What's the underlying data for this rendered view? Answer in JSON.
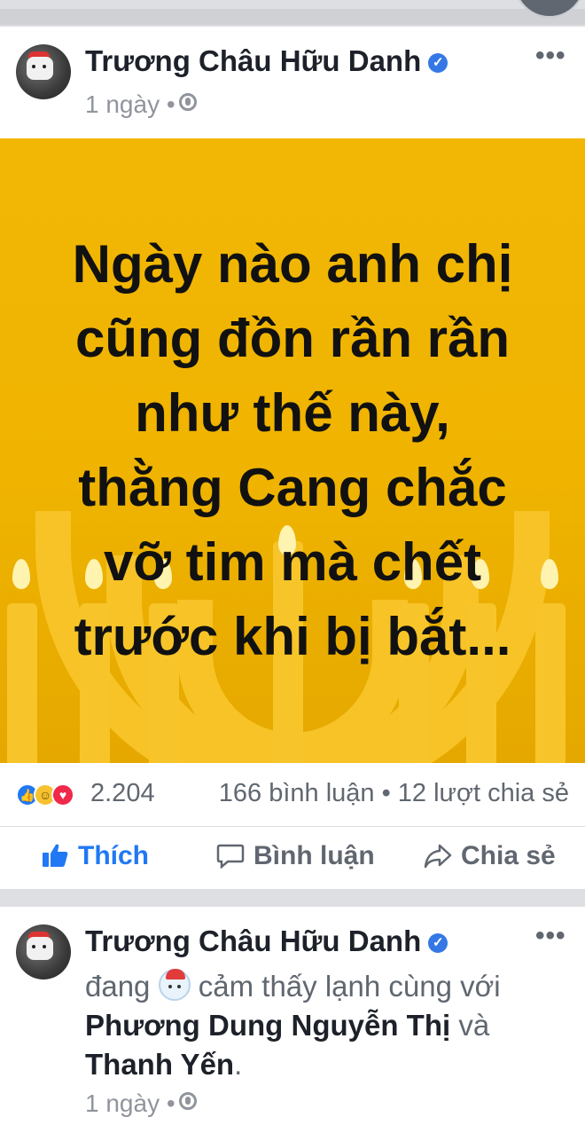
{
  "post1": {
    "author": "Trương Châu Hữu Danh",
    "verified_mark": "✓",
    "time": "1 ngày",
    "separator": "•",
    "more_label": "•••",
    "quote": "Ngày nào anh chị cũng đồn rần rần như thế này, thằng Cang chắc vỡ tim mà chết trước khi bị bắt...",
    "quote_lines": [
      "Ngày nào anh chị",
      "cũng đồn rần rần",
      "như thế này,",
      "thằng Cang chắc",
      "vỡ tim mà chết",
      "trước khi bị bắt..."
    ],
    "reaction_count": "2.204",
    "counts": "166 bình luận • 12 lượt chia sẻ",
    "actions": {
      "like": "Thích",
      "comment": "Bình luận",
      "share": "Chia sẻ"
    },
    "colors": {
      "background": "#f2b705",
      "like_blue": "#2078f4"
    }
  },
  "post2": {
    "author": "Trương Châu Hữu Danh",
    "verified_mark": "✓",
    "status_prefix": "đang",
    "feeling": "cảm thấy lạnh cùng",
    "with": "với",
    "friend1": "Phương Dung Nguyễn Thị",
    "and": "và",
    "friend2": "Thanh Yến",
    "period": ".",
    "time": "1 ngày",
    "separator": "•",
    "more_label": "•••"
  },
  "icons": {
    "globe": "globe-icon",
    "like": "thumbs-up-icon",
    "comment": "comment-bubble-icon",
    "share": "share-arrow-icon",
    "feeling_emoji": "cold-face-emoji"
  }
}
